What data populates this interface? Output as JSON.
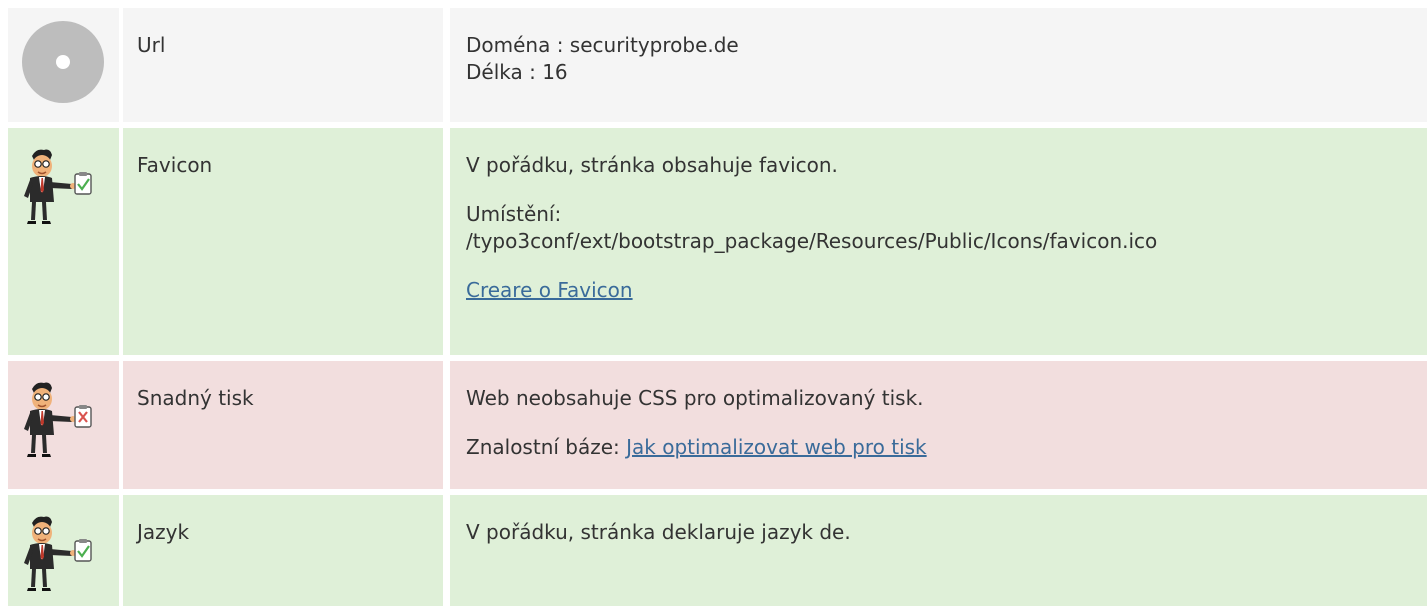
{
  "rows": [
    {
      "status": "neutral",
      "icon": "disc-icon",
      "label": "Url",
      "lines": [
        "Doména : securityprobe.de",
        "Délka : 16"
      ]
    },
    {
      "status": "good",
      "icon": "businessman-check-icon",
      "label": "Favicon",
      "line1": "V pořádku, stránka obsahuje favicon.",
      "line2": "Umístění:",
      "line3": "/typo3conf/ext/bootstrap_package/Resources/Public/Icons/favicon.ico",
      "link": "Creare o Favicon"
    },
    {
      "status": "bad",
      "icon": "businessman-cross-icon",
      "label": "Snadný tisk",
      "line1": "Web neobsahuje CSS pro optimalizovaný tisk.",
      "prefix": "Znalostní báze: ",
      "link": "Jak optimalizovat web pro tisk"
    },
    {
      "status": "good",
      "icon": "businessman-check-icon",
      "label": "Jazyk",
      "line1": "V pořádku, stránka deklaruje jazyk de."
    }
  ],
  "colors": {
    "neutral": "#f5f5f5",
    "good": "#dff0d8",
    "bad": "#f2dede",
    "link": "#3a6b9a",
    "check": "#4caf50",
    "cross": "#d9534f"
  }
}
